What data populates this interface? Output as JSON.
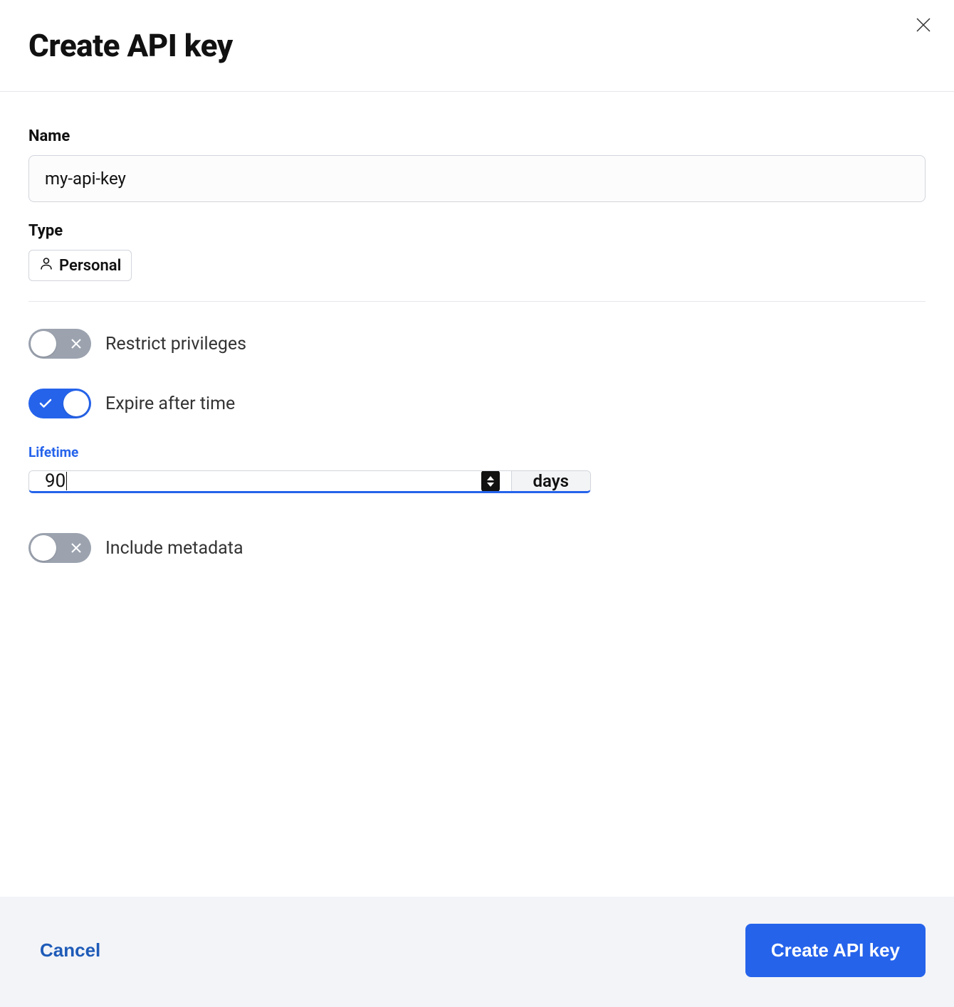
{
  "modal": {
    "title": "Create API key"
  },
  "fields": {
    "name": {
      "label": "Name",
      "value": "my-api-key"
    },
    "type": {
      "label": "Type",
      "value": "Personal"
    }
  },
  "toggles": {
    "restrict_privileges": {
      "label": "Restrict privileges",
      "enabled": false
    },
    "expire_after_time": {
      "label": "Expire after time",
      "enabled": true
    },
    "include_metadata": {
      "label": "Include metadata",
      "enabled": false
    }
  },
  "lifetime": {
    "label": "Lifetime",
    "value": "90",
    "unit": "days"
  },
  "footer": {
    "cancel": "Cancel",
    "submit": "Create API key"
  }
}
